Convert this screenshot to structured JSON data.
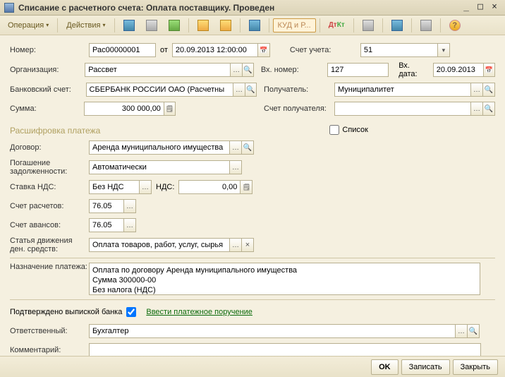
{
  "window": {
    "title": "Списание с расчетного счета: Оплата поставщику. Проведен"
  },
  "toolbar": {
    "operation": "Операция",
    "actions": "Действия",
    "kud": "КУД и Р..."
  },
  "labels": {
    "number": "Номер:",
    "from": "от",
    "org": "Организация:",
    "bank_acc": "Банковский счет:",
    "sum": "Сумма:",
    "acc_ucheta": "Счет учета:",
    "vh_nomer": "Вх. номер:",
    "vh_data": "Вх. дата:",
    "recipient": "Получатель:",
    "recipient_acc": "Счет получателя:",
    "list": "Список",
    "decoding": "Расшифровка платежа",
    "contract": "Договор:",
    "repayment": "Погашение задолженности:",
    "vat_rate": "Ставка НДС:",
    "vat": "НДС:",
    "acc_calc": "Счет расчетов:",
    "acc_advance": "Счет авансов:",
    "cash_flow": "Статья движения ден. средств:",
    "purpose": "Назначение платежа:",
    "confirmed": "Подтверждено выпиской банка",
    "enter_pp": "Ввести платежное поручение",
    "responsible": "Ответственный:",
    "comment": "Комментарий:"
  },
  "values": {
    "number": "Рас00000001",
    "date": "20.09.2013 12:00:00",
    "org": "Рассвет",
    "bank_acc": "СБЕРБАНК РОССИИ ОАО (Расчетны",
    "sum": "300 000,00",
    "acc_ucheta": "51",
    "vh_nomer": "127",
    "vh_data": "20.09.2013",
    "recipient": "Муниципалитет",
    "recipient_acc": "",
    "contract": "Аренда муниципального имущества",
    "repayment": "Автоматически",
    "vat_rate": "Без НДС",
    "vat": "0,00",
    "acc_calc": "76.05",
    "acc_advance": "76.05",
    "cash_flow": "Оплата товаров, работ, услуг, сырья",
    "purpose": "Оплата по договору Аренда муниципального имущества\nСумма 300000-00\nБез налога (НДС)",
    "responsible": "Бухгалтер",
    "comment": ""
  },
  "footer": {
    "ok": "OK",
    "save": "Записать",
    "close": "Закрыть"
  }
}
